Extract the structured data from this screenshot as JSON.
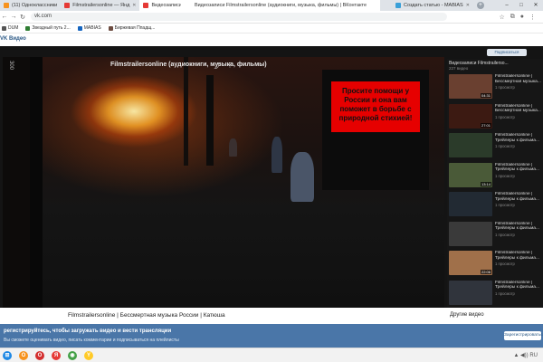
{
  "browser": {
    "tabs": [
      {
        "label": "(11) Одноклассники",
        "color": "#f7931e"
      },
      {
        "label": "Filmstrailersonline — Янд",
        "color": "#e53935"
      },
      {
        "label": "Видеозаписи Filmstr",
        "color": "#e53935"
      },
      {
        "label": "Создать статью - MABIAS",
        "color": "#3aa0d8"
      }
    ],
    "window_title": "Видеозаписи Filmstrailersonline (аудиокниги, музыка, фильмы) | ВКонтакте",
    "url": "vk.com",
    "window_controls": {
      "minimize": "–",
      "maximize": "□",
      "close": "✕"
    },
    "new_tab": "+",
    "bookmarks": [
      {
        "label": "DUM",
        "color": "#555555"
      },
      {
        "label": "Звездный путь 2...",
        "color": "#2e7d32"
      },
      {
        "label": "MABIAS",
        "color": "#1565c0"
      },
      {
        "label": "Биржевая Ппадщ...",
        "color": "#6d4c41"
      }
    ]
  },
  "vk": {
    "logo": "VK Видео",
    "channel_title": "Filmstrailersonline (аудиокниги, музыка, фильмы)",
    "subscribe_label": "Подписаться"
  },
  "video": {
    "title": "Filmstrailersonline | Бессмертная музыка России | Катюша",
    "banner_text": "Просите помощи у России и она вам поможет в борьбе с природной стихией!",
    "side_counter": "300"
  },
  "sidebar": {
    "heading": "Видеозаписи Filmstrailersо...",
    "subheading": "227 видео",
    "other_videos_label": "Другие видео",
    "items": [
      {
        "title": "Filmstrailersonline | Бессмертная музыка...",
        "views": "1 просмотр",
        "duration": "04:31",
        "thumb": "#6a4030"
      },
      {
        "title": "Filmstrailersonline | Бессмертная музыка...",
        "views": "1 просмотр",
        "duration": "27:01",
        "thumb": "#3c1a12"
      },
      {
        "title": "Filmstrailersonline | Трейлеры к фильма...",
        "views": "1 просмотр",
        "duration": "",
        "thumb": "#2b3b2a"
      },
      {
        "title": "Filmstrailersonline | Трейлеры к фильма...",
        "views": "1 просмотр",
        "duration": "13:14",
        "thumb": "#4a5a38"
      },
      {
        "title": "Filmstrailersonline | Трейлеры к фильма...",
        "views": "1 просмотр",
        "duration": "",
        "thumb": "#222a33"
      },
      {
        "title": "Filmstrailersonline | Трейлеры к фильма...",
        "views": "1 просмотр",
        "duration": "",
        "thumb": "#3a3a3a"
      },
      {
        "title": "Filmstrailersonline | Трейлеры к фильма...",
        "views": "1 просмотр",
        "duration": "22:06",
        "thumb": "#a0704a"
      },
      {
        "title": "Filmstrailersonline | Трейлеры к фильма...",
        "views": "1 просмотр",
        "duration": "",
        "thumb": "#30343c"
      }
    ]
  },
  "notice": {
    "title": "регистрируйтесь, чтобы загружать видео и вести трансляции",
    "text": "Вы сможете оценивать видео, писать комментарии и подписываться на плейлисты",
    "register_label": "Зарегистрироваться"
  },
  "taskbar": {
    "apps": [
      {
        "name": "windows",
        "color": "#1e88e5",
        "glyph": "⊞"
      },
      {
        "name": "ok",
        "color": "#f7931e",
        "glyph": "О"
      },
      {
        "name": "opera",
        "color": "#d32f2f",
        "glyph": "O"
      },
      {
        "name": "yandex",
        "color": "#e53935",
        "glyph": "Я"
      },
      {
        "name": "chrome",
        "color": "#43a047",
        "glyph": "◉"
      },
      {
        "name": "yandex-browser",
        "color": "#ffca28",
        "glyph": "Y"
      }
    ],
    "tray": "▲ ◀)) RU"
  }
}
